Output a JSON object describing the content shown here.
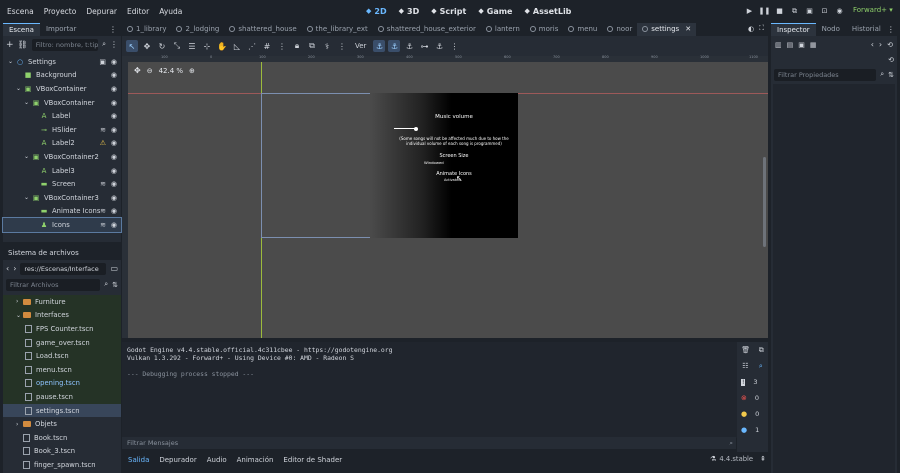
{
  "menu": [
    "Escena",
    "Proyecto",
    "Depurar",
    "Editor",
    "Ayuda"
  ],
  "workspaces": [
    {
      "label": "2D",
      "icon": "2d-icon",
      "active": true
    },
    {
      "label": "3D",
      "icon": "3d-icon",
      "active": false
    },
    {
      "label": "Script",
      "icon": "script-icon",
      "active": false
    },
    {
      "label": "Game",
      "icon": "game-icon",
      "active": false
    },
    {
      "label": "AssetLib",
      "icon": "assetlib-icon",
      "active": false
    }
  ],
  "renderer": "Forward+ ▾",
  "scene_dock": {
    "tabs": [
      "Escena",
      "Importar"
    ],
    "filter_placeholder": "Filtro: nombre, t:tipo",
    "tree": [
      {
        "label": "Settings",
        "depth": 0,
        "icon": "○",
        "color": "#6ab8ff",
        "extra": "▣"
      },
      {
        "label": "Background",
        "depth": 1,
        "icon": "■",
        "color": "#8fd16c"
      },
      {
        "label": "VBoxContainer",
        "depth": 1,
        "icon": "▣",
        "color": "#8fd16c"
      },
      {
        "label": "VBoxContainer",
        "depth": 2,
        "icon": "▣",
        "color": "#8fd16c"
      },
      {
        "label": "Label",
        "depth": 3,
        "icon": "A",
        "color": "#8fd16c"
      },
      {
        "label": "HSlider",
        "depth": 3,
        "icon": "⊸",
        "color": "#8fd16c",
        "extra": "≋"
      },
      {
        "label": "Label2",
        "depth": 3,
        "icon": "A",
        "color": "#8fd16c",
        "extra": "⚠",
        "extra_color": "#f2c94c"
      },
      {
        "label": "VBoxContainer2",
        "depth": 2,
        "icon": "▣",
        "color": "#8fd16c"
      },
      {
        "label": "Label3",
        "depth": 3,
        "icon": "A",
        "color": "#8fd16c"
      },
      {
        "label": "Screen",
        "depth": 3,
        "icon": "▬",
        "color": "#8fd16c",
        "extra": "≋"
      },
      {
        "label": "VBoxContainer3",
        "depth": 2,
        "icon": "▣",
        "color": "#8fd16c"
      },
      {
        "label": "Animate Icons",
        "depth": 3,
        "icon": "▬",
        "color": "#8fd16c",
        "extra": "≋"
      },
      {
        "label": "Icons",
        "depth": 3,
        "icon": "♟",
        "color": "#8fd16c",
        "extra": "≋",
        "selected": true
      }
    ]
  },
  "filesystem": {
    "title": "Sistema de archivos",
    "path": "res://Escenas/Interface",
    "filter_placeholder": "Filtrar Archivos",
    "items": [
      {
        "label": "Furniture",
        "type": "folder",
        "depth": 1,
        "hl": true
      },
      {
        "label": "Interfaces",
        "type": "folder",
        "depth": 1,
        "hl": true,
        "open": true
      },
      {
        "label": "FPS Counter.tscn",
        "type": "file",
        "depth": 2,
        "hl": true
      },
      {
        "label": "game_over.tscn",
        "type": "file",
        "depth": 2,
        "hl": true
      },
      {
        "label": "Load.tscn",
        "type": "file",
        "depth": 2,
        "hl": true
      },
      {
        "label": "menu.tscn",
        "type": "file",
        "depth": 2,
        "hl": true
      },
      {
        "label": "opening.tscn",
        "type": "file",
        "depth": 2,
        "hl": true,
        "color": "#8ec4ff"
      },
      {
        "label": "pause.tscn",
        "type": "file",
        "depth": 2,
        "hl": true
      },
      {
        "label": "settings.tscn",
        "type": "file",
        "depth": 2,
        "hl": true,
        "selected": true
      },
      {
        "label": "Objets",
        "type": "folder",
        "depth": 1
      },
      {
        "label": "Book.tscn",
        "type": "file",
        "depth": 1
      },
      {
        "label": "Book_3.tscn",
        "type": "file",
        "depth": 1
      },
      {
        "label": "finger_spawn.tscn",
        "type": "file",
        "depth": 1
      }
    ]
  },
  "scene_tabs": [
    {
      "label": "1_library",
      "active": false
    },
    {
      "label": "2_lodging",
      "active": false
    },
    {
      "label": "shattered_house",
      "active": false
    },
    {
      "label": "the_library_ext",
      "active": false
    },
    {
      "label": "shattered_house_exterior",
      "active": false
    },
    {
      "label": "lantern",
      "active": false
    },
    {
      "label": "moris",
      "active": false
    },
    {
      "label": "menu",
      "active": false
    },
    {
      "label": "noor",
      "active": false
    },
    {
      "label": "settings",
      "active": true
    }
  ],
  "editor_toolbar": {
    "view_label": "Ver"
  },
  "viewport": {
    "zoom": "42.4 %",
    "ruler_marks": [
      "100",
      "0",
      "100",
      "200",
      "300",
      "400",
      "500",
      "600",
      "700",
      "800",
      "900",
      "1000",
      "1100",
      "1200",
      "1300"
    ],
    "preview": {
      "music_title": "Music volume",
      "music_note": "(Some songs will not be affected much due to how the individual volume of each song is programmed)",
      "screen_title": "Screen Size",
      "screen_value": "Windowed",
      "icons_title": "Animate Icons",
      "icons_value": "Activated"
    }
  },
  "output": {
    "lines": [
      "Godot Engine v4.4.stable.official.4c311cbee - https://godotengine.org",
      "Vulkan 1.3.292 - Forward+ - Using Device #0: AMD - Radeon S",
      "",
      "--- Debugging process stopped ---"
    ],
    "filter_placeholder": "Filtrar Mensajes",
    "counts": [
      "3",
      "0",
      "0",
      "1"
    ]
  },
  "bottom_tabs": [
    "Salida",
    "Depurador",
    "Audio",
    "Animación",
    "Editor de Shader"
  ],
  "version": "4.4.stable",
  "inspector": {
    "tabs": [
      "Inspector",
      "Nodo",
      "Historial"
    ],
    "filter_placeholder": "Filtrar Propiedades"
  }
}
